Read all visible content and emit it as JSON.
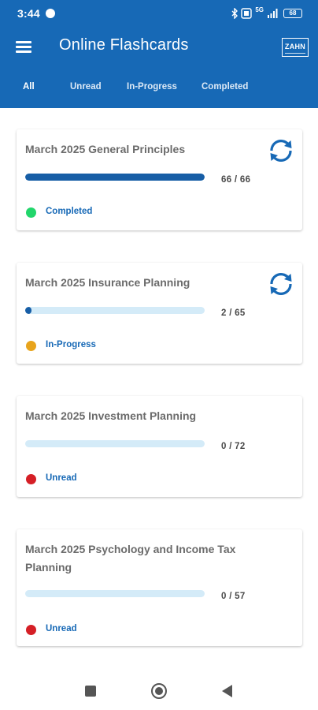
{
  "status_bar": {
    "time": "3:44",
    "battery": "68",
    "network": "5G"
  },
  "app_bar": {
    "title": "Online Flashcards",
    "logo_text": "ZAHN"
  },
  "tabs": [
    {
      "label": "All",
      "active": true
    },
    {
      "label": "Unread",
      "active": false
    },
    {
      "label": "In-Progress",
      "active": false
    },
    {
      "label": "Completed",
      "active": false
    }
  ],
  "colors": {
    "primary": "#1769b6",
    "progress_fill": "#175ea6",
    "progress_track": "#d4ebf8",
    "completed": "#22d66b",
    "in_progress": "#e8a41c",
    "unread": "#d51f26"
  },
  "cards": [
    {
      "title": "March 2025 General Principles",
      "progress_text": "66 / 66",
      "completed": 66,
      "total": 66,
      "status": "Completed",
      "status_color": "#22d66b",
      "icon": "sync-icon"
    },
    {
      "title": "March 2025 Insurance Planning",
      "progress_text": "2 / 65",
      "completed": 2,
      "total": 65,
      "status": "In-Progress",
      "status_color": "#e8a41c",
      "icon": "sync-icon"
    },
    {
      "title": "March 2025 Investment Planning",
      "progress_text": "0 / 72",
      "completed": 0,
      "total": 72,
      "status": "Unread",
      "status_color": "#d51f26"
    },
    {
      "title": "March 2025 Psychology and Income Tax Planning",
      "progress_text": "0 / 57",
      "completed": 0,
      "total": 57,
      "status": "Unread",
      "status_color": "#d51f26"
    }
  ],
  "nav": {
    "recent_icon": "square-icon",
    "home_icon": "circle-home-icon",
    "back_icon": "triangle-back-icon"
  }
}
